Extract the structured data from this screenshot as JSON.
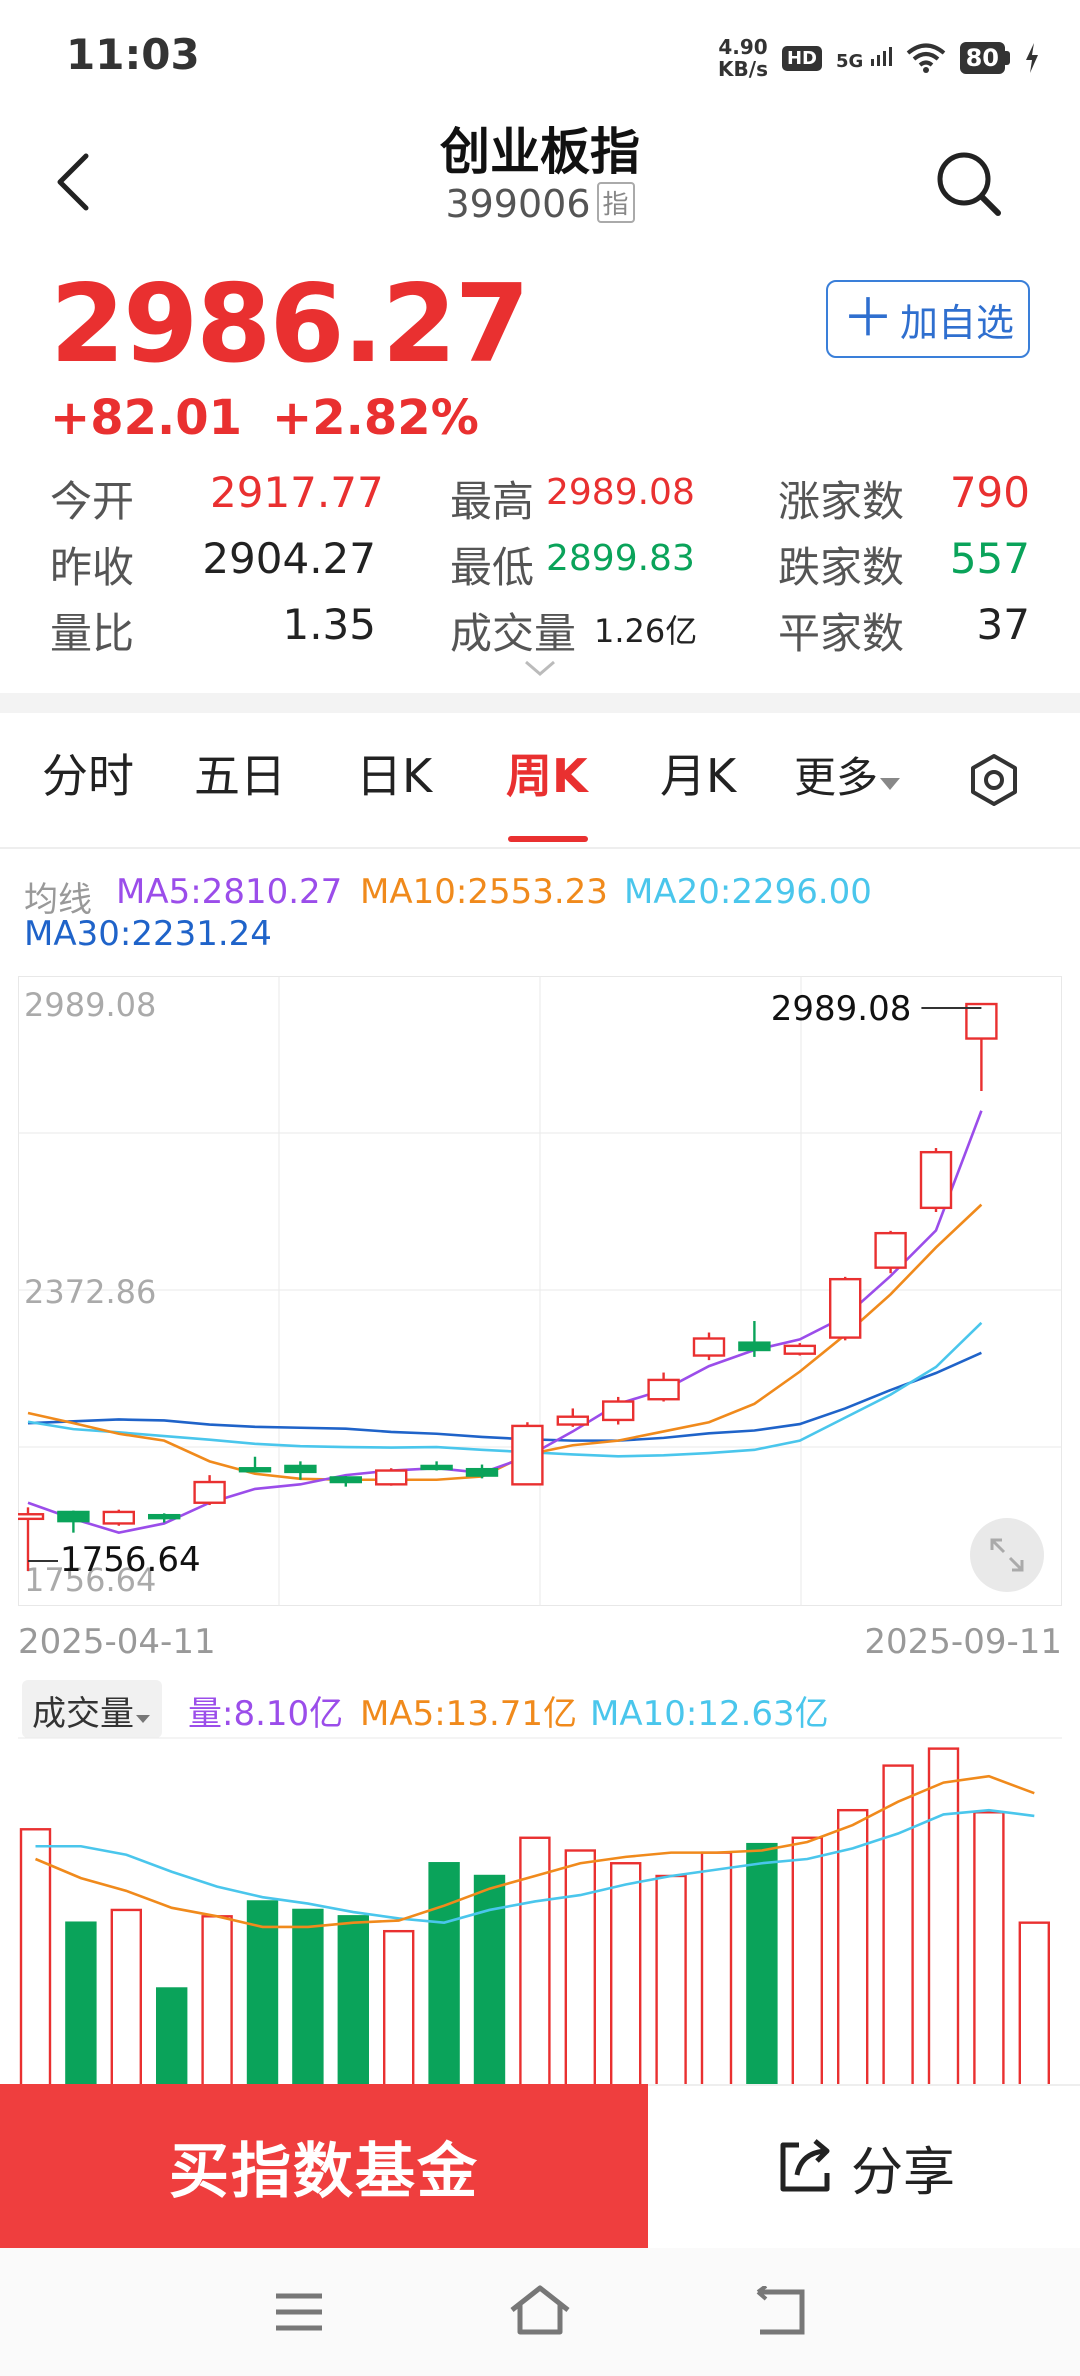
{
  "status_bar": {
    "time": "11:03",
    "net_speed": "4.90",
    "net_unit": "KB/s",
    "hd": "HD",
    "signal": "5G",
    "battery": "80"
  },
  "header": {
    "title": "创业板指",
    "code": "399006",
    "code_tag": "指"
  },
  "quote": {
    "price": "2986.27",
    "change": "+82.01",
    "change_pct": "+2.82%",
    "watch_icon": "＋",
    "watch_label": "加自选"
  },
  "stats": {
    "open_label": "今开",
    "open": "2917.77",
    "prev_close_label": "昨收",
    "prev_close": "2904.27",
    "vol_ratio_label": "量比",
    "vol_ratio": "1.35",
    "high_label": "最高",
    "high": "2989.08",
    "low_label": "最低",
    "low": "2899.83",
    "turnover_label": "成交量",
    "turnover": "1.26亿",
    "up_label": "涨家数",
    "up": "790",
    "down_label": "跌家数",
    "down": "557",
    "flat_label": "平家数",
    "flat": "37"
  },
  "tabs": [
    "分时",
    "五日",
    "日K",
    "周K",
    "月K",
    "更多"
  ],
  "active_tab": "周K",
  "ma_legend": {
    "label": "均线",
    "ma5": "MA5:2810.27",
    "ma10": "MA10:2553.23",
    "ma20": "MA20:2296.00",
    "ma30": "MA30:2231.24"
  },
  "colors": {
    "up": "#e93030",
    "down": "#0aa35a",
    "ma5": "#9b4dea",
    "ma10": "#f08a1c",
    "ma20": "#4ac6ec",
    "ma30": "#1f63c9"
  },
  "chart_data": {
    "type": "candlestick",
    "y_top_label": "2989.08",
    "y_mid_label": "2372.86",
    "y_bottom_label": "1756.64",
    "high_annotation": "2989.08",
    "low_annotation": "1756.64",
    "ylim": [
      1756.64,
      2989.08
    ],
    "x_start": "2025-04-11",
    "x_end": "2025-09-11",
    "candles": [
      {
        "o": 1870,
        "c": 1880,
        "h": 1895,
        "l": 1756.64
      },
      {
        "o": 1885,
        "c": 1865,
        "h": 1888,
        "l": 1840
      },
      {
        "o": 1860,
        "c": 1885,
        "h": 1890,
        "l": 1855
      },
      {
        "o": 1878,
        "c": 1874,
        "h": 1882,
        "l": 1862
      },
      {
        "o": 1905,
        "c": 1950,
        "h": 1965,
        "l": 1900
      },
      {
        "o": 1980,
        "c": 1978,
        "h": 2005,
        "l": 1975
      },
      {
        "o": 1985,
        "c": 1972,
        "h": 1995,
        "l": 1955
      },
      {
        "o": 1960,
        "c": 1950,
        "h": 1963,
        "l": 1940
      },
      {
        "o": 1945,
        "c": 1975,
        "h": 1980,
        "l": 1942
      },
      {
        "o": 1985,
        "c": 1982,
        "h": 1995,
        "l": 1975
      },
      {
        "o": 1978,
        "c": 1964,
        "h": 1988,
        "l": 1958
      },
      {
        "o": 1945,
        "c": 2072,
        "h": 2080,
        "l": 1943
      },
      {
        "o": 2075,
        "c": 2092,
        "h": 2110,
        "l": 2070
      },
      {
        "o": 2085,
        "c": 2125,
        "h": 2135,
        "l": 2075
      },
      {
        "o": 2130,
        "c": 2172,
        "h": 2188,
        "l": 2125
      },
      {
        "o": 2225,
        "c": 2262,
        "h": 2275,
        "l": 2215
      },
      {
        "o": 2253,
        "c": 2237,
        "h": 2300,
        "l": 2222
      },
      {
        "o": 2229,
        "c": 2246,
        "h": 2252,
        "l": 2225
      },
      {
        "o": 2264,
        "c": 2391,
        "h": 2396,
        "l": 2258
      },
      {
        "o": 2416,
        "c": 2491,
        "h": 2496,
        "l": 2404
      },
      {
        "o": 2546,
        "c": 2667,
        "h": 2676,
        "l": 2537
      },
      {
        "o": 2914,
        "c": 2989,
        "h": 2989.08,
        "l": 2800
      }
    ],
    "ma5": [
      1905,
      1870,
      1840,
      1860,
      1905,
      1935,
      1945,
      1965,
      1975,
      1980,
      1970,
      2005,
      2060,
      2120,
      2150,
      2202,
      2237,
      2260,
      2310,
      2398,
      2497,
      2757
    ],
    "ma10": [
      2100,
      2078,
      2055,
      2040,
      1995,
      1968,
      1957,
      1955,
      1955,
      1955,
      1962,
      2010,
      2030,
      2040,
      2060,
      2080,
      2120,
      2190,
      2270,
      2358,
      2460,
      2553
    ],
    "ma20": [
      2081,
      2065,
      2058,
      2050,
      2042,
      2033,
      2028,
      2026,
      2025,
      2026,
      2020,
      2015,
      2010,
      2006,
      2008,
      2013,
      2020,
      2040,
      2090,
      2140,
      2200,
      2296
    ],
    "ma30": [
      2078,
      2082,
      2086,
      2084,
      2075,
      2070,
      2068,
      2066,
      2059,
      2055,
      2048,
      2043,
      2040,
      2040,
      2046,
      2056,
      2062,
      2076,
      2110,
      2150,
      2187,
      2231
    ]
  },
  "volume": {
    "selector": "成交量",
    "legend_vol": "量:8.10亿",
    "legend_ma5": "MA5:13.71亿",
    "legend_ma10": "MA10:12.63亿",
    "bars": [
      {
        "v": 12.0,
        "up": true
      },
      {
        "v": 7.6,
        "up": false
      },
      {
        "v": 8.2,
        "up": true
      },
      {
        "v": 4.5,
        "up": false
      },
      {
        "v": 7.9,
        "up": true
      },
      {
        "v": 8.6,
        "up": false
      },
      {
        "v": 8.2,
        "up": false
      },
      {
        "v": 7.9,
        "up": false
      },
      {
        "v": 7.2,
        "up": true
      },
      {
        "v": 10.4,
        "up": false
      },
      {
        "v": 9.8,
        "up": false
      },
      {
        "v": 11.6,
        "up": true
      },
      {
        "v": 11.0,
        "up": true
      },
      {
        "v": 10.4,
        "up": true
      },
      {
        "v": 9.8,
        "up": true
      },
      {
        "v": 10.9,
        "up": true
      },
      {
        "v": 11.3,
        "up": false
      },
      {
        "v": 11.6,
        "up": true
      },
      {
        "v": 12.9,
        "up": true
      },
      {
        "v": 15.0,
        "up": true
      },
      {
        "v": 15.8,
        "up": true
      },
      {
        "v": 12.8,
        "up": true
      },
      {
        "v": 7.6,
        "up": true
      }
    ],
    "ma5": [
      10.6,
      9.7,
      9.1,
      8.3,
      7.9,
      7.4,
      7.4,
      7.6,
      7.7,
      8.4,
      9.2,
      9.8,
      10.4,
      10.7,
      10.9,
      10.9,
      11.0,
      11.4,
      12.2,
      13.3,
      14.2,
      14.5,
      13.7
    ],
    "ma10": [
      11.2,
      11.2,
      10.8,
      10.0,
      9.3,
      8.8,
      8.5,
      8.1,
      7.8,
      7.6,
      8.2,
      8.6,
      8.9,
      9.4,
      9.8,
      10.1,
      10.4,
      10.6,
      11.1,
      11.8,
      12.7,
      12.9,
      12.63
    ]
  },
  "bottom": {
    "buy_label": "买指数基金",
    "share_label": "分享"
  }
}
